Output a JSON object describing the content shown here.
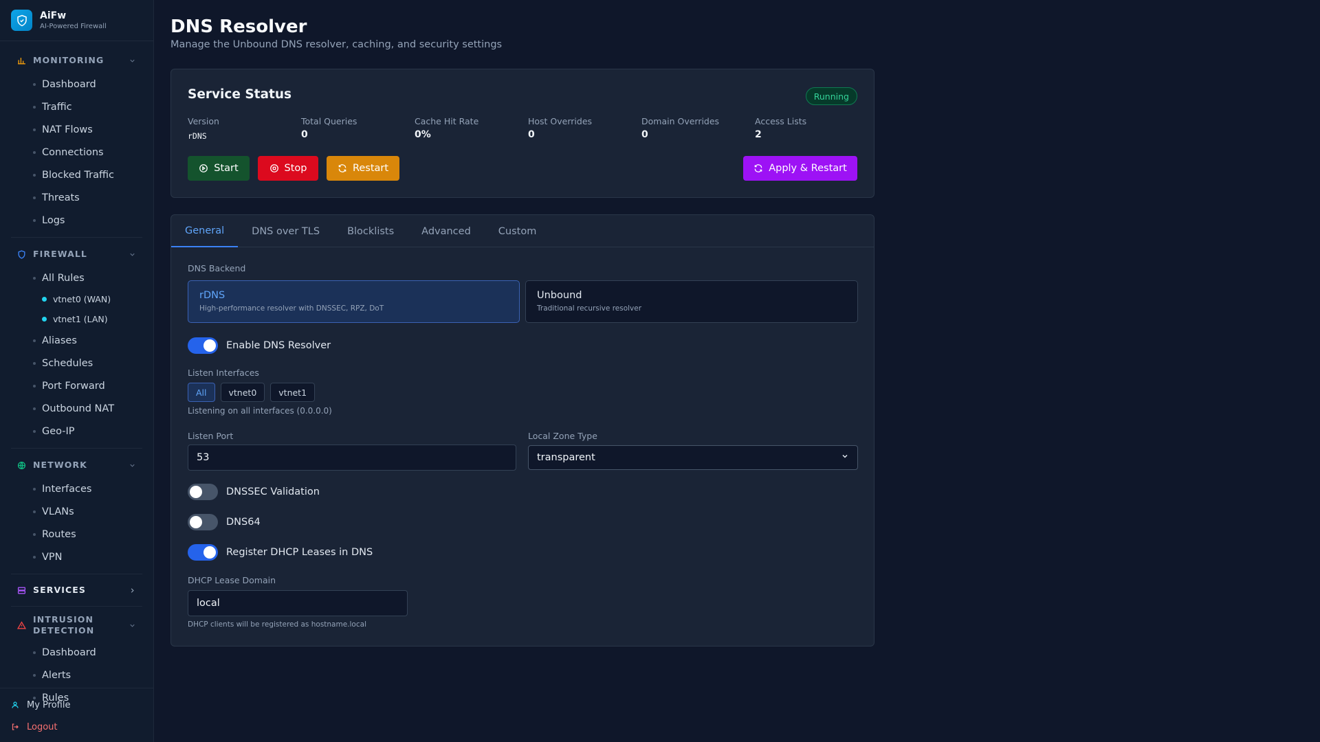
{
  "brand": {
    "name": "AiFw",
    "tagline": "AI-Powered Firewall"
  },
  "sidebar": {
    "sections": [
      {
        "title": "MONITORING",
        "icon": "bar-chart-icon",
        "color": "#f59e0b",
        "expanded": true,
        "items": [
          "Dashboard",
          "Traffic",
          "NAT Flows",
          "Connections",
          "Blocked Traffic",
          "Threats",
          "Logs"
        ]
      },
      {
        "title": "FIREWALL",
        "icon": "shield-icon",
        "color": "#3b82f6",
        "expanded": true,
        "items": [
          "All Rules",
          "Aliases",
          "Schedules",
          "Port Forward",
          "Outbound NAT",
          "Geo-IP"
        ],
        "subitems": [
          "vtnet0 (WAN)",
          "vtnet1 (LAN)"
        ]
      },
      {
        "title": "NETWORK",
        "icon": "globe-icon",
        "color": "#10b981",
        "expanded": true,
        "items": [
          "Interfaces",
          "VLANs",
          "Routes",
          "VPN"
        ]
      },
      {
        "title": "SERVICES",
        "icon": "server-icon",
        "color": "#a855f7",
        "expanded": false,
        "items": []
      },
      {
        "title_line1": "INTRUSION",
        "title_line2": "DETECTION",
        "icon": "alert-triangle-icon",
        "color": "#ef4444",
        "expanded": true,
        "items": [
          "Dashboard",
          "Alerts",
          "Rules"
        ]
      }
    ],
    "footer": {
      "profile": "My Profile",
      "logout": "Logout"
    }
  },
  "page": {
    "title": "DNS Resolver",
    "subtitle": "Manage the Unbound DNS resolver, caching, and security settings"
  },
  "status": {
    "title": "Service Status",
    "badge": "Running",
    "stats": [
      {
        "label": "Version",
        "value": "rDNS"
      },
      {
        "label": "Total Queries",
        "value": "0"
      },
      {
        "label": "Cache Hit Rate",
        "value": "0%"
      },
      {
        "label": "Host Overrides",
        "value": "0"
      },
      {
        "label": "Domain Overrides",
        "value": "0"
      },
      {
        "label": "Access Lists",
        "value": "2"
      }
    ],
    "buttons": {
      "start": "Start",
      "stop": "Stop",
      "restart": "Restart",
      "apply": "Apply & Restart"
    }
  },
  "tabs": [
    "General",
    "DNS over TLS",
    "Blocklists",
    "Advanced",
    "Custom"
  ],
  "general": {
    "backend_label": "DNS Backend",
    "backends": [
      {
        "name": "rDNS",
        "desc": "High-performance resolver with DNSSEC, RPZ, DoT",
        "selected": true
      },
      {
        "name": "Unbound",
        "desc": "Traditional recursive resolver",
        "selected": false
      }
    ],
    "enable_resolver": {
      "label": "Enable DNS Resolver",
      "on": true
    },
    "listen_interfaces_label": "Listen Interfaces",
    "interfaces": [
      "All",
      "vtnet0",
      "vtnet1"
    ],
    "listen_hint": "Listening on all interfaces (0.0.0.0)",
    "listen_port_label": "Listen Port",
    "listen_port": "53",
    "local_zone_label": "Local Zone Type",
    "local_zone": "transparent",
    "dnssec": {
      "label": "DNSSEC Validation",
      "on": false
    },
    "dns64": {
      "label": "DNS64",
      "on": false
    },
    "register_dhcp": {
      "label": "Register DHCP Leases in DNS",
      "on": true
    },
    "dhcp_domain_label": "DHCP Lease Domain",
    "dhcp_domain": "local",
    "dhcp_hint": "DHCP clients will be registered as hostname.local"
  }
}
